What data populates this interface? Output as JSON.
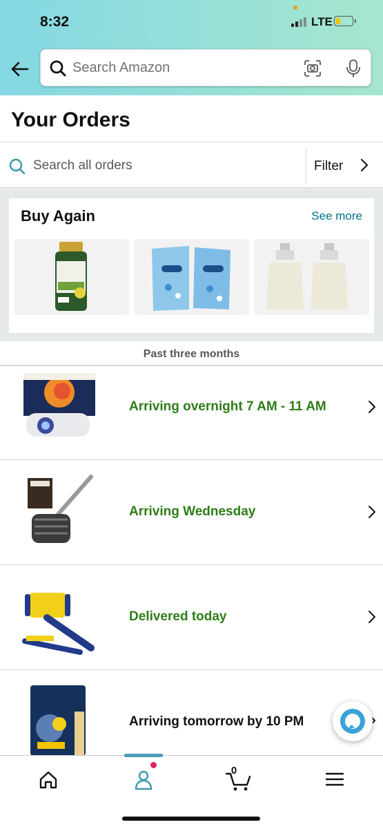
{
  "status_bar": {
    "time": "8:32",
    "network": "LTE"
  },
  "search": {
    "placeholder": "Search Amazon"
  },
  "page": {
    "title": "Your Orders"
  },
  "order_search": {
    "placeholder": "Search all orders",
    "filter_label": "Filter"
  },
  "buy_again": {
    "title": "Buy Again",
    "see_more": "See more",
    "items": [
      {
        "name": "Oil of Oregano 4000mg supplement"
      },
      {
        "name": "PetSafe ScoopFree litter"
      },
      {
        "name": "Rare Pearls perfume"
      }
    ]
  },
  "section_label": "Past three months",
  "orders": [
    {
      "status": "Arriving overnight 7 AM - 11 AM",
      "color": "#2e7d17",
      "product": "projector"
    },
    {
      "status": "Arriving Wednesday",
      "color": "#2e7d17",
      "product": "grill brush"
    },
    {
      "status": "Delivered today",
      "color": "#2e7d17",
      "product": "lint roller"
    },
    {
      "status": "Arriving tomorrow by 10 PM",
      "color": "#0f1111",
      "product": "wax beads"
    }
  ],
  "tabbar": {
    "items": [
      "home-icon",
      "account-icon",
      "cart-icon",
      "menu-icon"
    ],
    "cart_count": "0",
    "active": "account-icon"
  },
  "colors": {
    "accent": "#007185",
    "delivered_green": "#2e7d17",
    "header_start": "#84d8e3",
    "header_end": "#a6e6ce"
  }
}
